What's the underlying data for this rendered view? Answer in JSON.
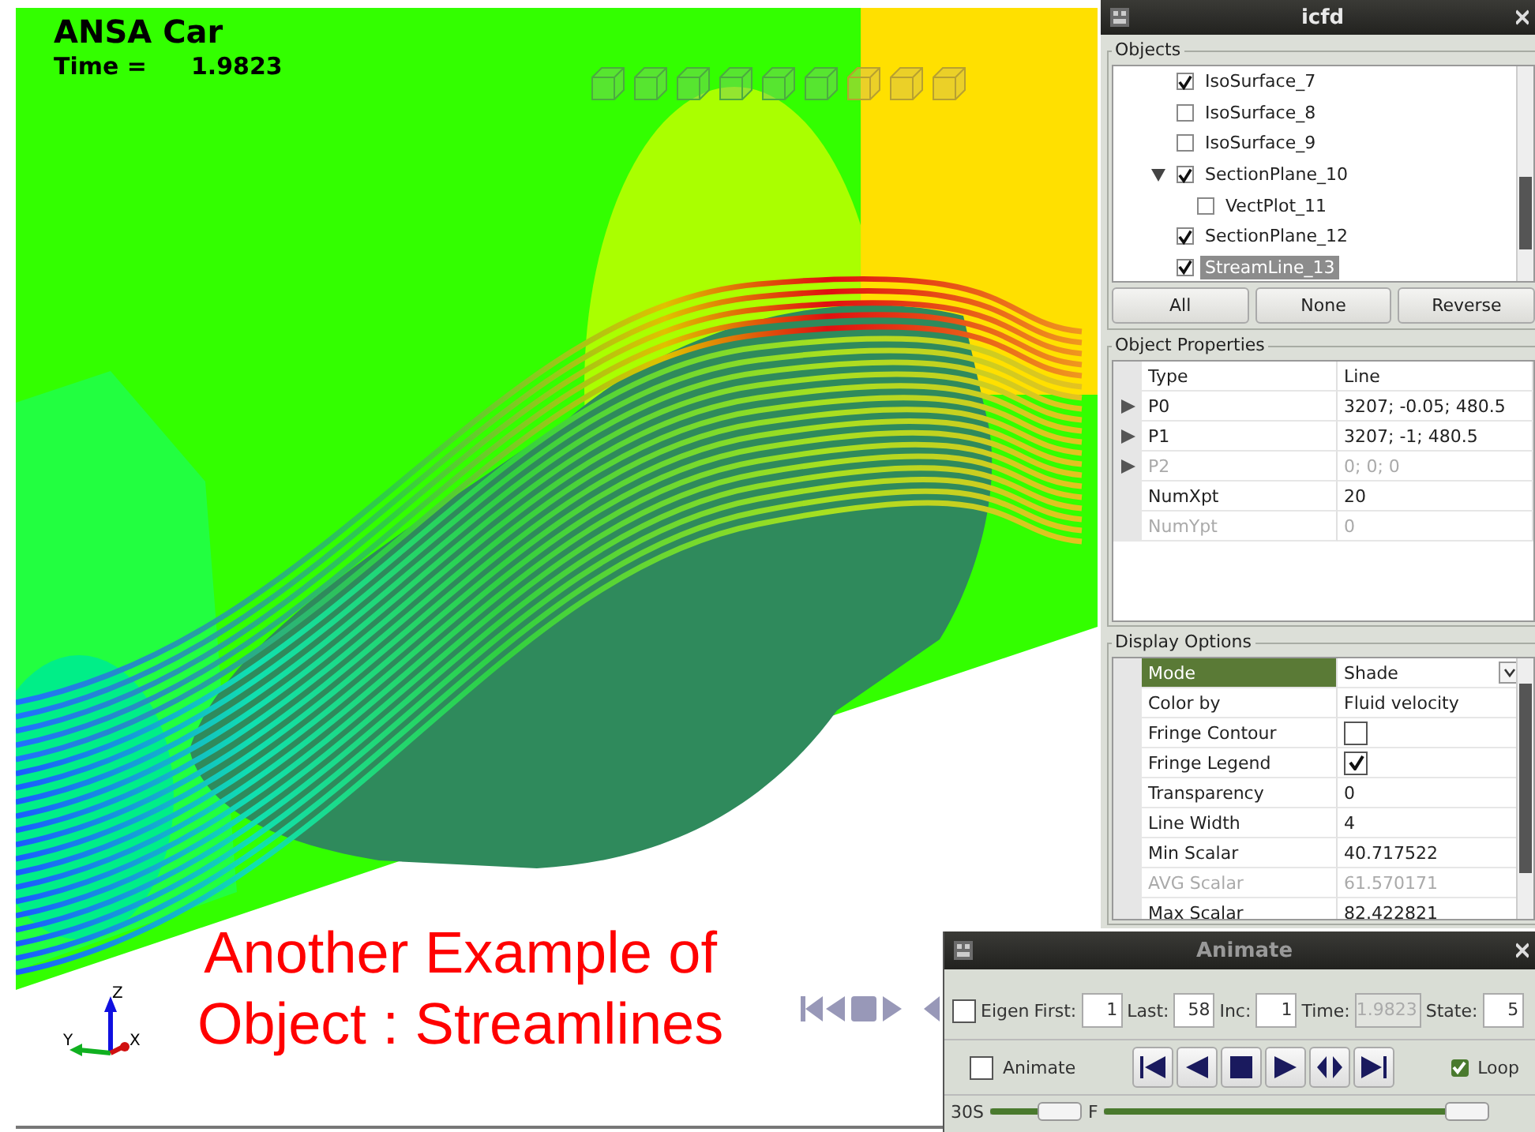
{
  "viewport": {
    "title": "ANSA Car",
    "time_label": "Time =",
    "time_value": "1.9823",
    "caption": [
      "Another Example of",
      "Object : Streamlines"
    ],
    "axis_labels": [
      "Z",
      "Y",
      "X"
    ]
  },
  "panel": {
    "title": "icfd",
    "objects": {
      "label": "Objects",
      "items": [
        {
          "label": "IsoSurface_7",
          "checked": true,
          "selected": false
        },
        {
          "label": "IsoSurface_8",
          "checked": false,
          "selected": false
        },
        {
          "label": "IsoSurface_9",
          "checked": false,
          "selected": false
        },
        {
          "label": "SectionPlane_10",
          "checked": true,
          "selected": false,
          "expanded": true,
          "children": [
            {
              "label": "VectPlot_11",
              "checked": false,
              "selected": false
            }
          ]
        },
        {
          "label": "SectionPlane_12",
          "checked": true,
          "selected": false
        },
        {
          "label": "StreamLine_13",
          "checked": true,
          "selected": true
        }
      ],
      "buttons": [
        "All",
        "None",
        "Reverse"
      ]
    },
    "properties": {
      "label": "Object Properties",
      "rows": [
        {
          "name": "Type",
          "value": "Line",
          "expandable": false,
          "disabled": false
        },
        {
          "name": "P0",
          "value": "3207; -0.05; 480.5",
          "expandable": true,
          "disabled": false
        },
        {
          "name": "P1",
          "value": "3207; -1; 480.5",
          "expandable": true,
          "disabled": false
        },
        {
          "name": "P2",
          "value": "0; 0; 0",
          "expandable": true,
          "disabled": true
        },
        {
          "name": "NumXpt",
          "value": "20",
          "expandable": false,
          "disabled": false
        },
        {
          "name": "NumYpt",
          "value": "0",
          "expandable": false,
          "disabled": true
        }
      ]
    },
    "display": {
      "label": "Display Options",
      "rows": [
        {
          "kind": "dropdown",
          "name": "Mode",
          "value": "Shade",
          "selected": true,
          "disabled": false
        },
        {
          "kind": "text",
          "name": "Color by",
          "value": "Fluid velocity",
          "selected": false,
          "disabled": false
        },
        {
          "kind": "checkbox",
          "name": "Fringe Contour",
          "checked": false,
          "selected": false,
          "disabled": false
        },
        {
          "kind": "checkbox",
          "name": "Fringe Legend",
          "checked": true,
          "selected": false,
          "disabled": false
        },
        {
          "kind": "text",
          "name": "Transparency",
          "value": "0",
          "selected": false,
          "disabled": false
        },
        {
          "kind": "text",
          "name": "Line Width",
          "value": "4",
          "selected": false,
          "disabled": false
        },
        {
          "kind": "text",
          "name": "Min Scalar",
          "value": "40.717522",
          "selected": false,
          "disabled": false
        },
        {
          "kind": "text",
          "name": "AVG Scalar",
          "value": "61.570171",
          "selected": false,
          "disabled": true
        },
        {
          "kind": "text",
          "name": "Max Scalar",
          "value": "82.422821",
          "selected": false,
          "disabled": false
        }
      ]
    }
  },
  "animate": {
    "title": "Animate",
    "eigen": {
      "label": "Eigen",
      "checked": false
    },
    "fields": [
      {
        "label": "First:",
        "value": "1",
        "disabled": false
      },
      {
        "label": "Last:",
        "value": "58",
        "disabled": false
      },
      {
        "label": "Inc:",
        "value": "1",
        "disabled": false
      },
      {
        "label": "Time:",
        "value": "1.9823",
        "disabled": true
      },
      {
        "label": "State:",
        "value": "5",
        "disabled": false
      }
    ],
    "animate_toggle": {
      "label": "Animate",
      "checked": false
    },
    "playback_buttons": [
      {
        "kind": "first"
      },
      {
        "kind": "back"
      },
      {
        "kind": "stop"
      },
      {
        "kind": "play"
      },
      {
        "kind": "bounce"
      },
      {
        "kind": "last"
      }
    ],
    "loop": {
      "label": "Loop",
      "checked": true
    },
    "speed": {
      "label": "30S",
      "level": 1
    },
    "frame": {
      "label": "F",
      "level": 1
    }
  }
}
